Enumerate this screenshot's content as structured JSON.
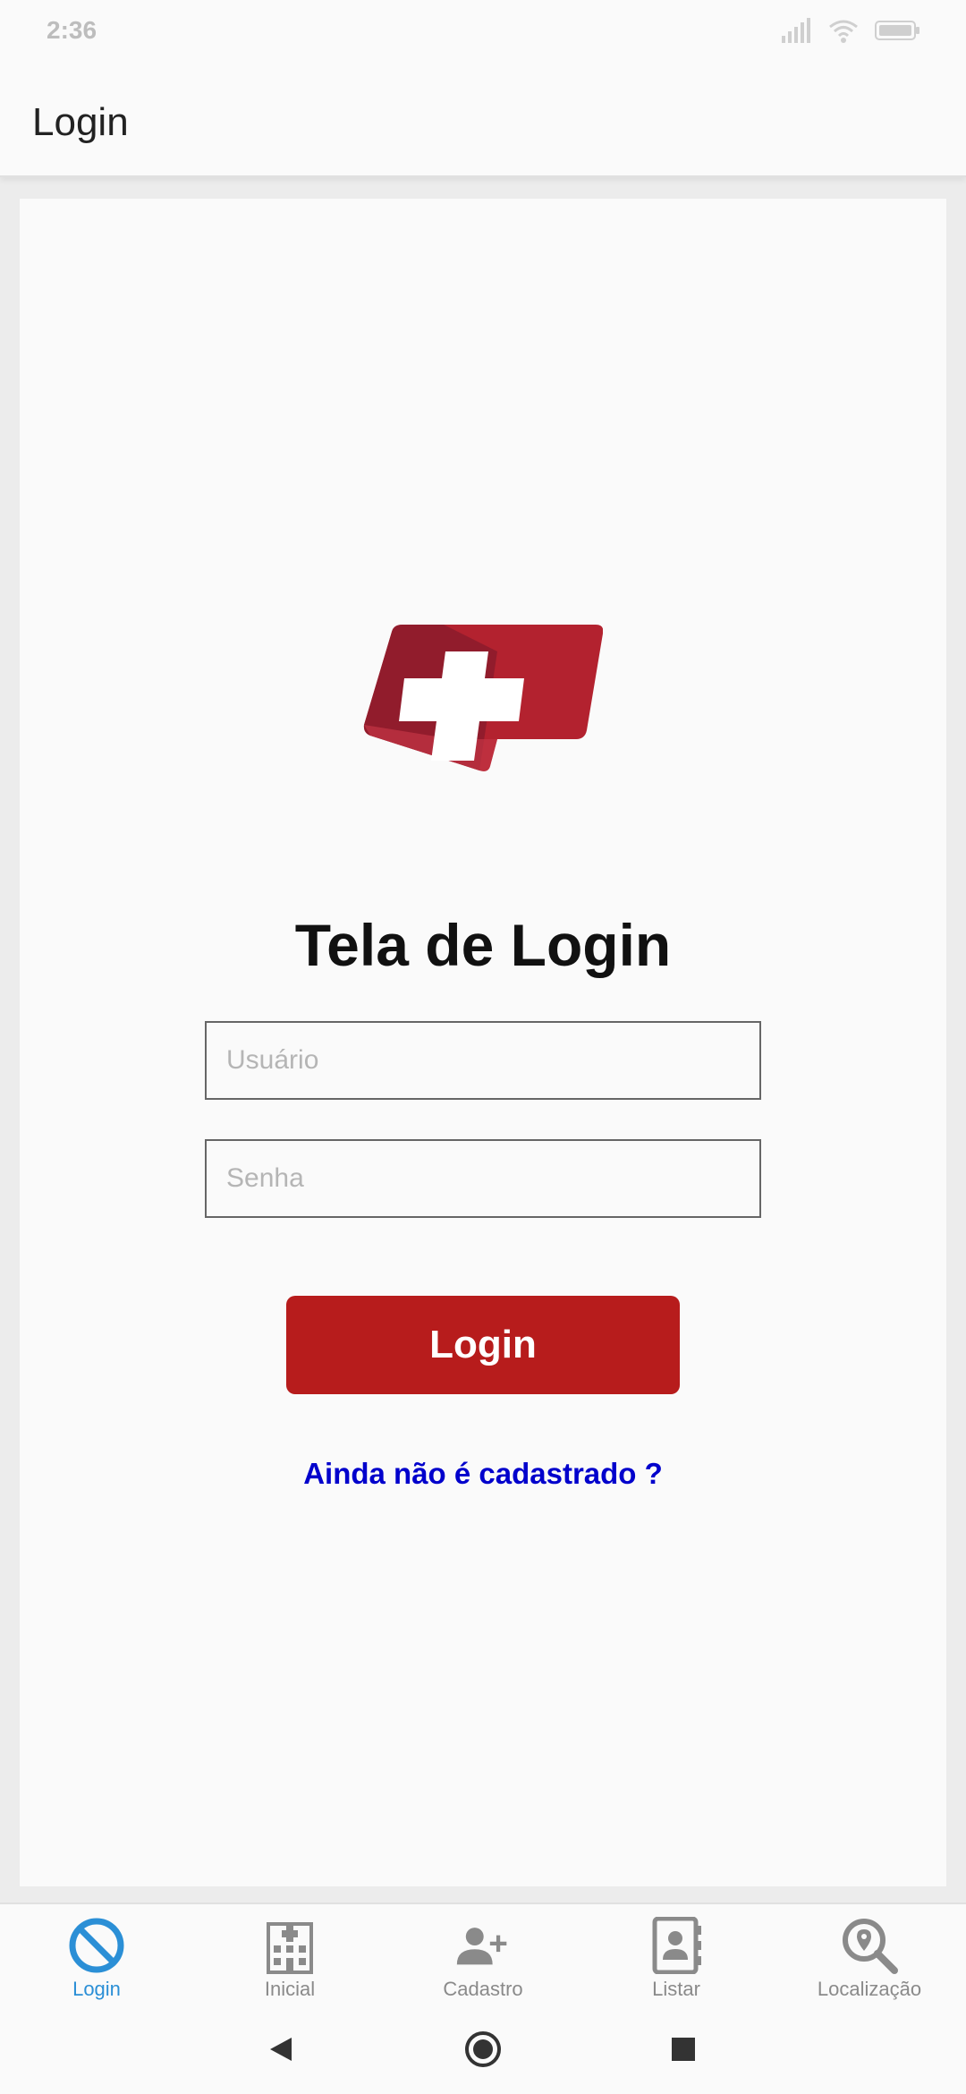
{
  "status_bar": {
    "time": "2:36"
  },
  "app_bar": {
    "title": "Login"
  },
  "main": {
    "heading": "Tela de Login",
    "username_placeholder": "Usuário",
    "password_placeholder": "Senha",
    "login_button": "Login",
    "signup_link": "Ainda não é cadastrado ?"
  },
  "bottom_nav": {
    "items": [
      {
        "label": "Login",
        "icon": "block-icon",
        "active": true
      },
      {
        "label": "Inicial",
        "icon": "hospital-icon",
        "active": false
      },
      {
        "label": "Cadastro",
        "icon": "add-user-icon",
        "active": false
      },
      {
        "label": "Listar",
        "icon": "contacts-book-icon",
        "active": false
      },
      {
        "label": "Localização",
        "icon": "location-search-icon",
        "active": false
      }
    ]
  },
  "colors": {
    "brand_red": "#b71c1c",
    "link_blue": "#0000cc",
    "active_tab": "#2b8fd6"
  }
}
